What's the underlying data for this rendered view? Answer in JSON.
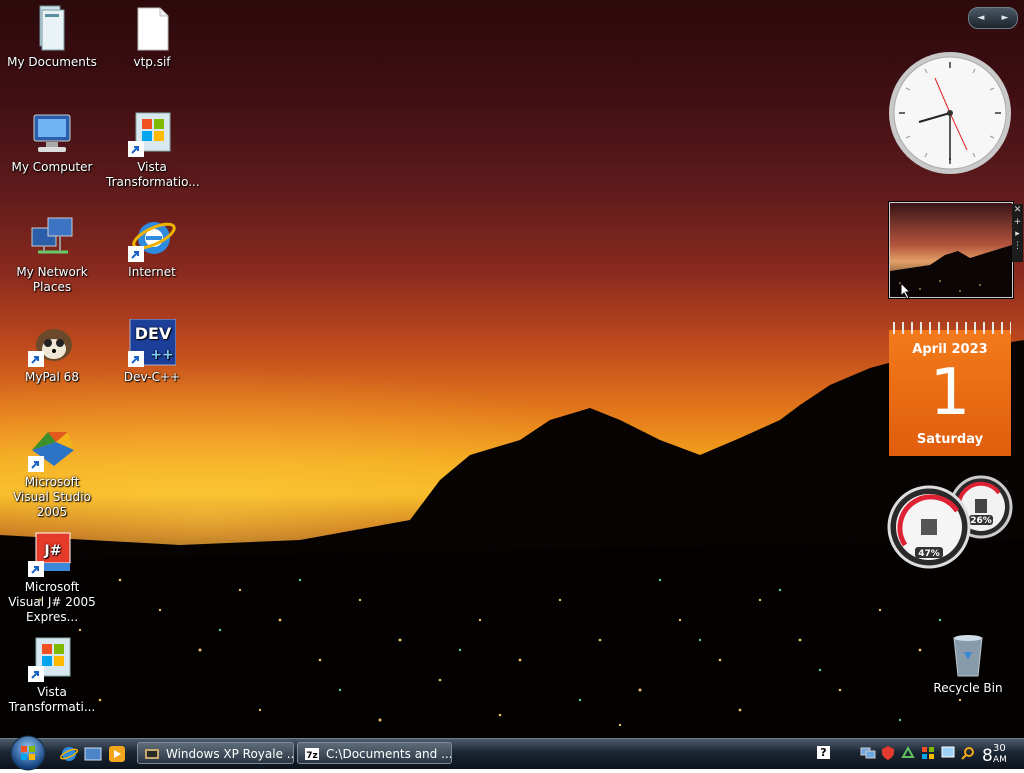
{
  "desktop_icons": [
    {
      "label": "My Documents",
      "icon": "folder-documents-icon"
    },
    {
      "label": "vtp.sif",
      "icon": "file-icon"
    },
    {
      "label": "My Computer",
      "icon": "computer-icon"
    },
    {
      "label": "Vista Transformatio...",
      "icon": "vista-installer-icon"
    },
    {
      "label": "My Network Places",
      "icon": "network-icon"
    },
    {
      "label": "Internet",
      "icon": "internet-explorer-icon"
    },
    {
      "label": "MyPal 68",
      "icon": "mypal-icon"
    },
    {
      "label": "Dev-C++",
      "icon": "dev-cpp-icon"
    },
    {
      "label": "Microsoft Visual Studio 2005",
      "icon": "visual-studio-icon"
    },
    {
      "label": "Microsoft Visual J# 2005 Expres...",
      "icon": "visual-jsharp-icon"
    },
    {
      "label": "Vista Transformati...",
      "icon": "vista-installer-icon"
    },
    {
      "label": "Recycle Bin",
      "icon": "recycle-bin-icon"
    }
  ],
  "sidebar": {
    "nav_left": "◄",
    "nav_right": "►",
    "calendar": {
      "month": "April 2023",
      "day": "1",
      "weekday": "Saturday"
    },
    "cpu_meter": {
      "cpu_percent": "47%",
      "memory_percent": "26%"
    },
    "slideshow_controls": [
      "✕",
      "+",
      "▸",
      "⋮"
    ]
  },
  "taskbar": {
    "tasks": [
      {
        "label": "Windows XP Royale ...",
        "icon": "theme-icon"
      },
      {
        "label": "C:\\Documents and ...",
        "icon": "7zip-icon"
      }
    ],
    "help_glyph": "?",
    "clock": {
      "hour": "8",
      "minute": "30",
      "ampm": "AM"
    }
  },
  "colors": {
    "calendar_orange": "#ee6f15",
    "taskbar_dark": "#0c131c"
  }
}
